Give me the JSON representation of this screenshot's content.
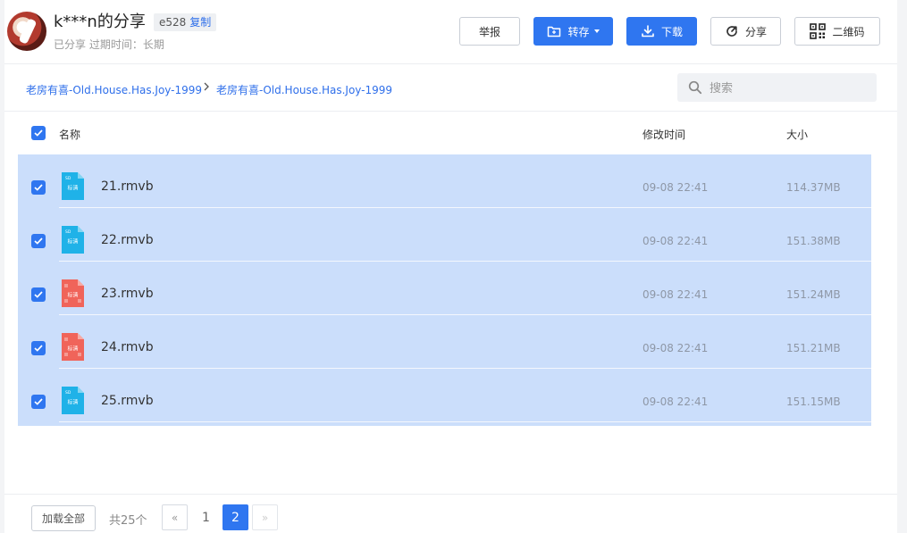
{
  "share": {
    "title": "k***n的分享",
    "code": "e528",
    "copy_label": "复制",
    "meta": "已分享 过期时间：长期"
  },
  "toolbar": {
    "report_label": "举报",
    "save_label": "转存",
    "download_label": "下载",
    "share_label": "分享",
    "qrcode_label": "二维码"
  },
  "breadcrumb": [
    "老房有喜-Old.House.Has.Joy-1999",
    "老房有喜-Old.House.Has.Joy-1999"
  ],
  "search": {
    "placeholder": "搜索"
  },
  "table": {
    "columns": {
      "name": "名称",
      "modified": "修改时间",
      "size": "大小"
    },
    "rows": [
      {
        "name": "21.rmvb",
        "modified": "09-08 22:41",
        "size": "114.37MB",
        "icon": "video-file-blue-icon",
        "badge": "标清"
      },
      {
        "name": "22.rmvb",
        "modified": "09-08 22:41",
        "size": "151.38MB",
        "icon": "video-file-blue-icon",
        "badge": "标清"
      },
      {
        "name": "23.rmvb",
        "modified": "09-08 22:41",
        "size": "151.24MB",
        "icon": "video-file-red-icon",
        "badge": "标清"
      },
      {
        "name": "24.rmvb",
        "modified": "09-08 22:41",
        "size": "151.21MB",
        "icon": "video-file-red-icon",
        "badge": "标清"
      },
      {
        "name": "25.rmvb",
        "modified": "09-08 22:41",
        "size": "151.15MB",
        "icon": "video-file-blue-icon",
        "badge": "标清"
      }
    ]
  },
  "footer": {
    "load_all_label": "加载全部",
    "total_label": "共25个",
    "prev_label": "«",
    "next_label": "»",
    "pages": [
      "1",
      "2"
    ],
    "current_page": "2"
  },
  "colors": {
    "accent": "#2f76f0",
    "selected_row": "#cbdefb",
    "link": "#2f6fea",
    "video_blue": "#1fb2e8",
    "video_red": "#f0645a"
  }
}
